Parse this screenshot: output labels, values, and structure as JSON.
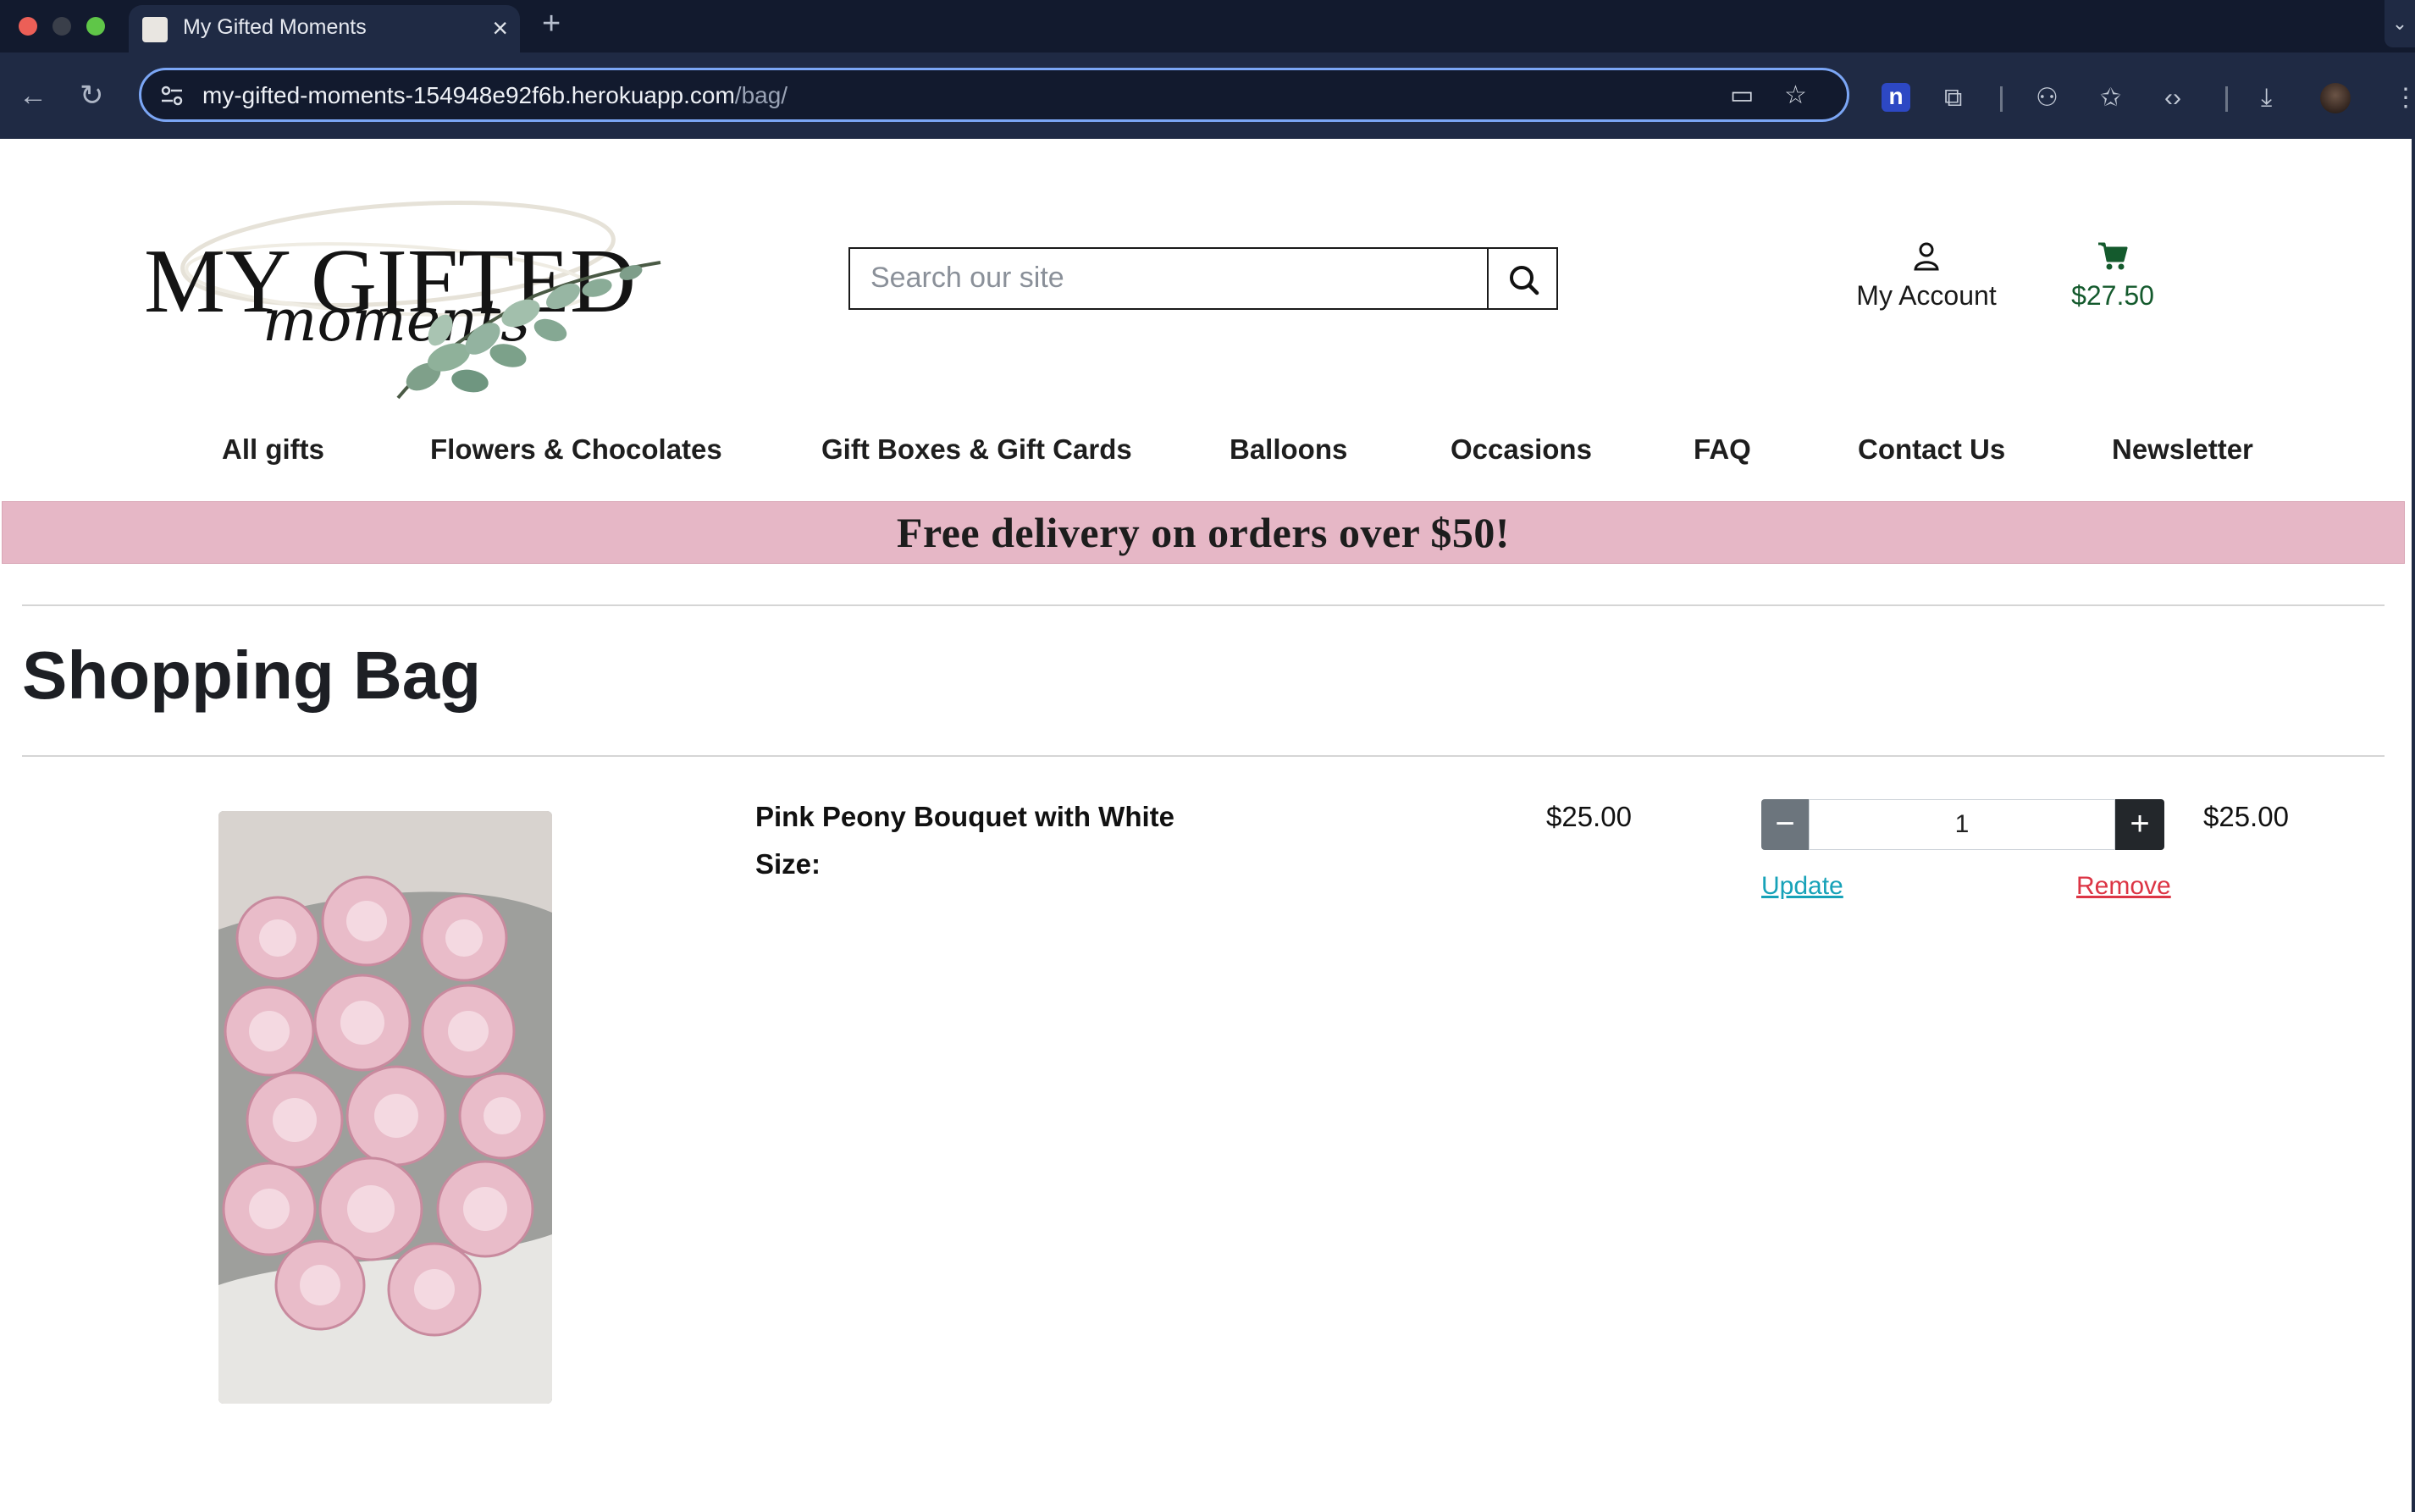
{
  "browser": {
    "tab_title": "My Gifted Moments",
    "url_host": "my-gifted-moments-154948e92f6b.herokuapp.com",
    "url_path": "/bag/",
    "extension_n_label": "n"
  },
  "header": {
    "logo_text_main": "MY GIFTED",
    "logo_text_script": "moments",
    "search_placeholder": "Search our site",
    "account_label": "My Account",
    "bag_total": "$27.50",
    "bag_total_color": "#145a2d"
  },
  "nav": {
    "items": [
      "All gifts",
      "Flowers & Chocolates",
      "Gift Boxes & Gift Cards",
      "Balloons",
      "Occasions",
      "FAQ",
      "Contact Us",
      "Newsletter"
    ]
  },
  "promo": {
    "text": "Free delivery on orders over $50!",
    "background": "#e6b7c6"
  },
  "page": {
    "title": "Shopping Bag"
  },
  "bag": {
    "items": [
      {
        "name": "Pink Peony Bouquet with White",
        "size_label": "Size:",
        "price": "$25.00",
        "quantity": "1",
        "decrement": "−",
        "increment": "+",
        "update_label": "Update",
        "remove_label": "Remove",
        "subtotal": "$25.00"
      }
    ]
  },
  "colors": {
    "update_link": "#17a2b8",
    "remove_link": "#dc3545"
  }
}
